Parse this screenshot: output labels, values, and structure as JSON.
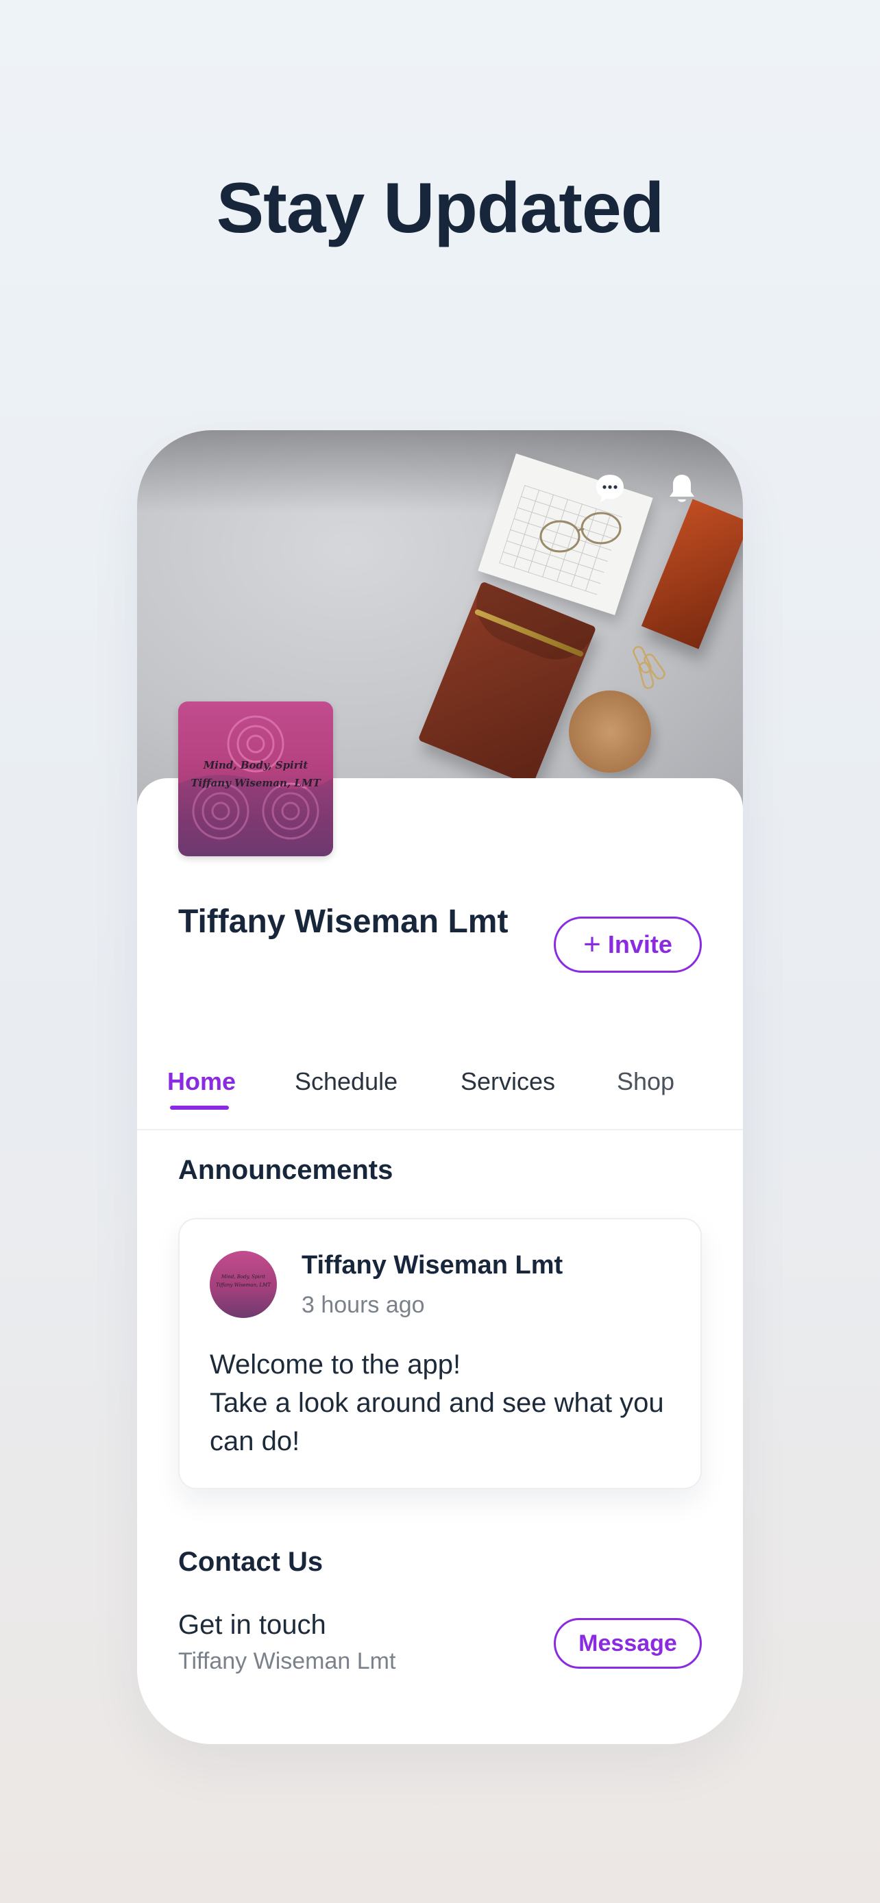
{
  "headline": "Stay Updated",
  "cover": {
    "icons": [
      "chat-bubble-icon",
      "bell-icon"
    ]
  },
  "business": {
    "logo_line1": "Mind, Body, Spirit",
    "logo_line2": "Tiffany Wiseman, LMT",
    "name": "Tiffany Wiseman Lmt",
    "invite_label": "Invite"
  },
  "tabs": [
    {
      "label": "Home",
      "active": true
    },
    {
      "label": "Schedule",
      "active": false
    },
    {
      "label": "Services",
      "active": false
    },
    {
      "label": "Shop",
      "active": false
    }
  ],
  "announcements": {
    "title": "Announcements",
    "post": {
      "author": "Tiffany Wiseman Lmt",
      "time": "3 hours ago",
      "body_line1": "Welcome to the app!",
      "body_line2": "Take a look around and see what you can do!"
    }
  },
  "contact": {
    "title": "Contact Us",
    "line1": "Get in touch",
    "line2": "Tiffany Wiseman Lmt",
    "message_label": "Message"
  },
  "colors": {
    "accent": "#8a2be2",
    "text_dark": "#17263a",
    "text_muted": "#7a818b",
    "logo_pink": "#c24c8e"
  }
}
